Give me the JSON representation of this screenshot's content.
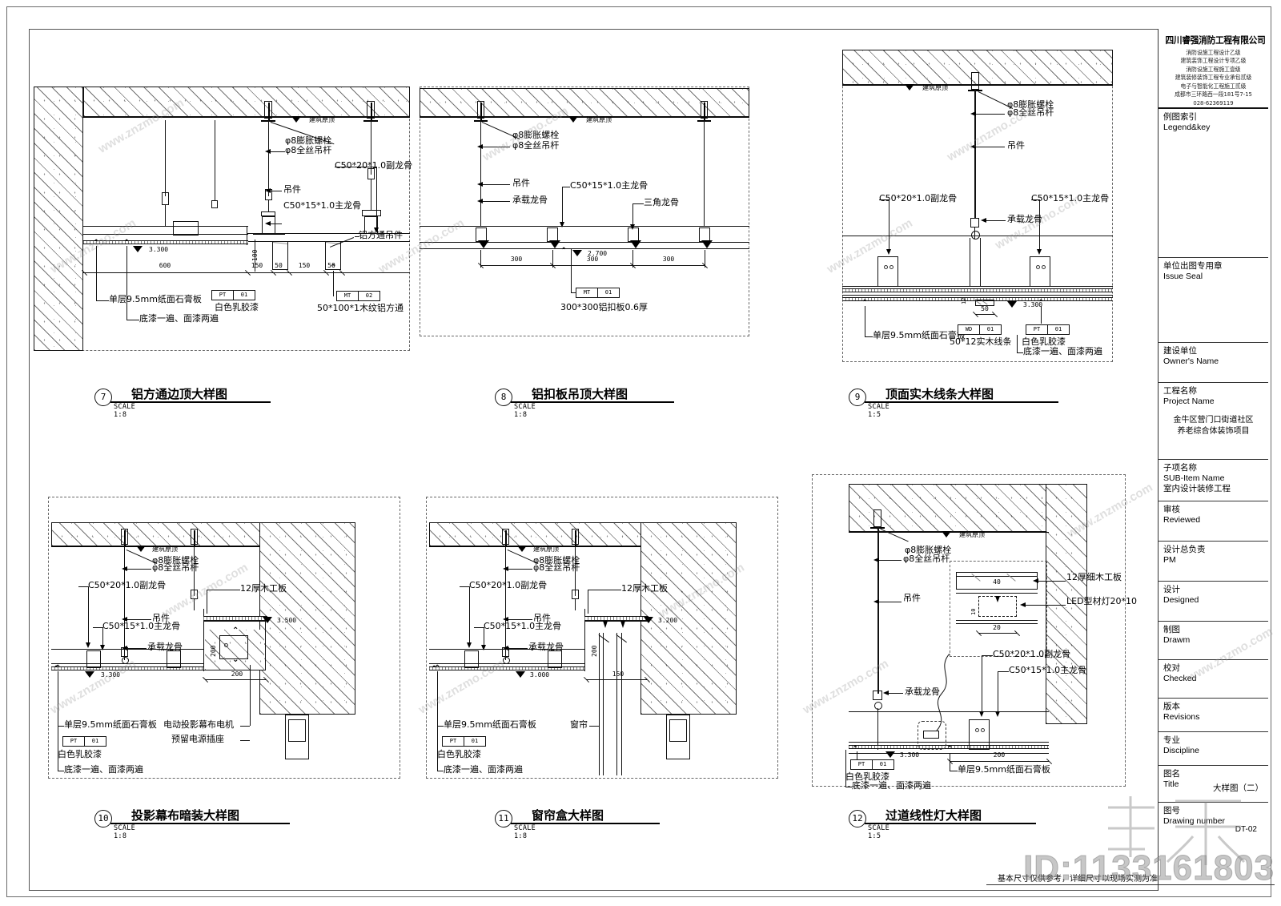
{
  "sheet": {
    "footer_note": "基本尺寸仅供参考，详细尺寸以现场实测为准",
    "watermark_text": "www.znzmo.com",
    "watermark_id": "ID:1133161803"
  },
  "title_block": {
    "company": {
      "name": "四川睿强消防工程有限公司",
      "lines": [
        "消防设施工程设计乙级",
        "建筑装饰工程设计专项乙级",
        "消防设施工程施工壹级",
        "建筑装修装饰工程专业承包贰级",
        "电子与智能化工程施工贰级",
        "成都市三环路西一段181号7-15",
        "028-62369119"
      ]
    },
    "rows": [
      {
        "name": "legend",
        "cn": "例图索引",
        "en": "Legend&key",
        "value": ""
      },
      {
        "name": "issue-seal",
        "cn": "单位出图专用章",
        "en": "Issue Seal",
        "value": ""
      },
      {
        "name": "owner",
        "cn": "建设单位",
        "en": "Owner's Name",
        "value": ""
      },
      {
        "name": "project",
        "cn": "工程名称",
        "en": "Project Name",
        "value": "金牛区营门口街道社区\n养老综合体装饰项目"
      },
      {
        "name": "subitem",
        "cn": "子项名称",
        "en": "SUB-Item Name",
        "value": "室内设计装修工程"
      },
      {
        "name": "reviewed",
        "cn": "审核",
        "en": "Reviewed",
        "value": ""
      },
      {
        "name": "pm",
        "cn": "设计总负责",
        "en": "PM",
        "value": ""
      },
      {
        "name": "designed",
        "cn": "设计",
        "en": "Designed",
        "value": ""
      },
      {
        "name": "drawn",
        "cn": "制图",
        "en": "Drawm",
        "value": ""
      },
      {
        "name": "checked",
        "cn": "校对",
        "en": "Checked",
        "value": ""
      },
      {
        "name": "revisions",
        "cn": "版本",
        "en": "Revisions",
        "value": ""
      },
      {
        "name": "discipline",
        "cn": "专业",
        "en": "Discipline",
        "value": ""
      },
      {
        "name": "title",
        "cn": "图名",
        "en": "Title",
        "value": "大样图（二）"
      },
      {
        "name": "number",
        "cn": "图号",
        "en": "Drawing number",
        "value": "DT-02"
      }
    ]
  },
  "details": {
    "d7": {
      "number": "7",
      "title": "铝方通边顶大样图",
      "scale": "SCALE 1:8",
      "labels": {
        "slab": "建筑原顶",
        "anchor": "φ8膨胀螺栓",
        "rod": "φ8全丝吊杆",
        "hanger": "吊件",
        "sub_keel": "C50*20*1.0副龙骨",
        "main_keel": "C50*15*1.0主龙骨",
        "tube_hanger": "铝方通吊件",
        "board": "单层9.5mm纸面石膏板",
        "paint": "白色乳胶漆",
        "paint_note": "底漆一遍、面漆两遍",
        "tube": "50*100*1木纹铝方通"
      },
      "tags": [
        {
          "code": "PT",
          "num": "01"
        },
        {
          "code": "MT",
          "num": "02"
        }
      ],
      "dims": [
        "600",
        "150",
        "50",
        "150",
        "50",
        "100"
      ],
      "elevation": "3.300"
    },
    "d8": {
      "number": "8",
      "title": "铝扣板吊顶大样图",
      "scale": "SCALE 1:8",
      "labels": {
        "slab": "建筑原顶",
        "anchor": "φ8膨胀螺栓",
        "rod": "φ8全丝吊杆",
        "hanger": "吊件",
        "bearing_keel": "承载龙骨",
        "main_keel": "C50*15*1.0主龙骨",
        "tri_keel": "三角龙骨",
        "panel": "300*300铝扣板0.6厚"
      },
      "tags": [
        {
          "code": "MT",
          "num": "01"
        }
      ],
      "dims": [
        "300",
        "300",
        "300"
      ],
      "elevation": "2.700"
    },
    "d9": {
      "number": "9",
      "title": "顶面实木线条大样图",
      "scale": "SCALE 1:5",
      "labels": {
        "slab": "建筑原顶",
        "anchor": "φ8膨胀螺栓",
        "rod": "φ8全丝吊杆",
        "hanger": "吊件",
        "sub_keel": "C50*20*1.0副龙骨",
        "main_keel": "C50*15*1.0主龙骨",
        "bearing_keel": "承载龙骨",
        "board": "单层9.5mm纸面石膏板",
        "wood_line": "50*12实木线条",
        "paint": "白色乳胶漆",
        "paint_note": "底漆一遍、面漆两遍"
      },
      "tags": [
        {
          "code": "WD",
          "num": "01"
        },
        {
          "code": "PT",
          "num": "01"
        }
      ],
      "dims": [
        "50",
        "12"
      ],
      "elevation": "3.300"
    },
    "d10": {
      "number": "10",
      "title": "投影幕布暗装大样图",
      "scale": "SCALE 1:8",
      "labels": {
        "slab": "建筑原顶",
        "anchor": "φ8膨胀螺栓",
        "rod": "φ8全丝吊杆",
        "sub_keel": "C50*20*1.0副龙骨",
        "hanger": "吊件",
        "main_keel": "C50*15*1.0主龙骨",
        "bearing_keel": "承载龙骨",
        "plywood": "12厚木工板",
        "board": "单层9.5mm纸面石膏板",
        "motor": "电动投影幕布电机",
        "socket": "预留电源插座",
        "paint": "白色乳胶漆",
        "paint_note": "底漆一遍、面漆两遍"
      },
      "tags": [
        {
          "code": "PT",
          "num": "01"
        }
      ],
      "dims": [
        "200",
        "200"
      ],
      "elevations": [
        "3.300",
        "3.500"
      ]
    },
    "d11": {
      "number": "11",
      "title": "窗帘盒大样图",
      "scale": "SCALE 1:8",
      "labels": {
        "slab": "建筑原顶",
        "anchor": "φ8膨胀螺栓",
        "rod": "φ8全丝吊杆",
        "sub_keel": "C50*20*1.0副龙骨",
        "hanger": "吊件",
        "main_keel": "C50*15*1.0主龙骨",
        "bearing_keel": "承载龙骨",
        "plywood": "12厚木工板",
        "board": "单层9.5mm纸面石膏板",
        "curtain": "窗帘",
        "paint": "白色乳胶漆",
        "paint_note": "底漆一遍、面漆两遍"
      },
      "tags": [
        {
          "code": "PT",
          "num": "01"
        }
      ],
      "dims": [
        "200",
        "150"
      ],
      "elevations": [
        "3.000",
        "3.200"
      ]
    },
    "d12": {
      "number": "12",
      "title": "过道线性灯大样图",
      "scale": "SCALE 1:5",
      "labels": {
        "slab": "建筑原顶",
        "anchor": "φ8膨胀螺栓",
        "rod": "φ8全丝吊杆",
        "hanger": "吊件",
        "bearing_keel": "承载龙骨",
        "plywood": "12厚细木工板",
        "led": "LED型材灯20*10",
        "sub_keel": "C50*20*1.0副龙骨",
        "main_keel": "C50*15*1.0主龙骨",
        "board": "单层9.5mm纸面石膏板",
        "paint": "白色乳胶漆",
        "paint_note": "底漆一遍、面漆两遍"
      },
      "tags": [
        {
          "code": "PT",
          "num": "01"
        }
      ],
      "dims": [
        "40",
        "20",
        "10",
        "200"
      ],
      "elevation": "3.300"
    }
  }
}
